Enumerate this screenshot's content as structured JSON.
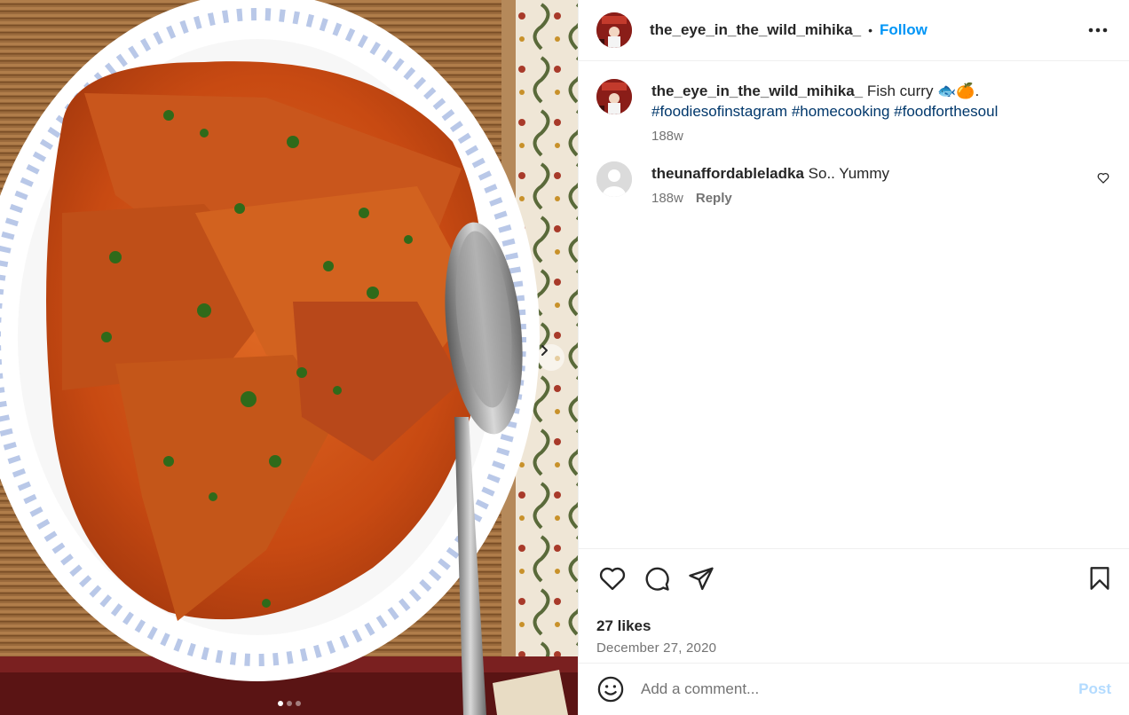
{
  "post": {
    "username": "the_eye_in_the_wild_mihika_",
    "separator": "•",
    "follow_label": "Follow",
    "more_icon": "more-horizontal-icon"
  },
  "caption": {
    "username": "the_eye_in_the_wild_mihika_",
    "text": "Fish curry",
    "emojis": "🐟🍊",
    "trailing": ".",
    "hashtags": [
      "#foodiesofinstagram",
      "#homecooking",
      "#foodforthesoul"
    ],
    "time": "188w"
  },
  "comments": [
    {
      "username": "theunaffordableladka",
      "text": "So.. Yummy",
      "time": "188w",
      "reply_label": "Reply"
    }
  ],
  "actions": {
    "icons": [
      "heart-icon",
      "comment-icon",
      "share-icon",
      "bookmark-icon"
    ],
    "likes": "27 likes",
    "date": "December 27, 2020"
  },
  "composer": {
    "placeholder": "Add a comment...",
    "post_label": "Post"
  },
  "media": {
    "alt": "Fish curry on a white oval plate",
    "carousel_count": 3,
    "carousel_active": 1
  },
  "colors": {
    "accent": "#0095f6",
    "hashtag": "#00376b",
    "muted": "#737373",
    "post_disabled": "#b3dbff"
  }
}
